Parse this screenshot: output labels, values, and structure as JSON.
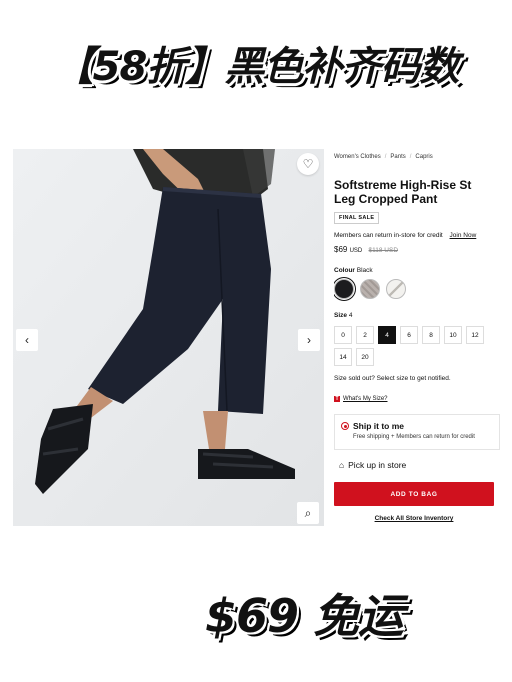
{
  "banner": {
    "headline": "【58折】黑色补齐码数",
    "footer": "$69 免运"
  },
  "breadcrumb": [
    "Women's Clothes",
    "Pants",
    "Capris"
  ],
  "product": {
    "title_line1": "Softstreme High-Rise St",
    "title_line2": "Leg Cropped Pant",
    "badge": "FINAL SALE",
    "member_note": "Members can return in-store for credit",
    "join_link": "Join Now",
    "price": "$69",
    "currency": "USD",
    "old_price": "$118 USD",
    "colour_label": "Colour",
    "colour_value": "Black",
    "swatch_colors": [
      "#1c1c1e",
      "#b9b1ad",
      "#e3e1dc"
    ],
    "size_label": "Size",
    "size_value": "4",
    "sizes": [
      "0",
      "2",
      "4",
      "6",
      "8",
      "10",
      "12",
      "14",
      "20"
    ],
    "selected_size": "4",
    "sold_out_note": "Size sold out? Select size to get notified.",
    "my_size_link": "What's My Size?"
  },
  "fulfillment": {
    "ship_title": "Ship it to me",
    "ship_sub": "Free shipping + Members can return for credit",
    "pickup": "Pick up in store"
  },
  "actions": {
    "add_to_bag": "ADD TO BAG",
    "inventory": "Check All Store Inventory"
  },
  "colors": {
    "accent": "#d0111e",
    "text": "#111111"
  }
}
